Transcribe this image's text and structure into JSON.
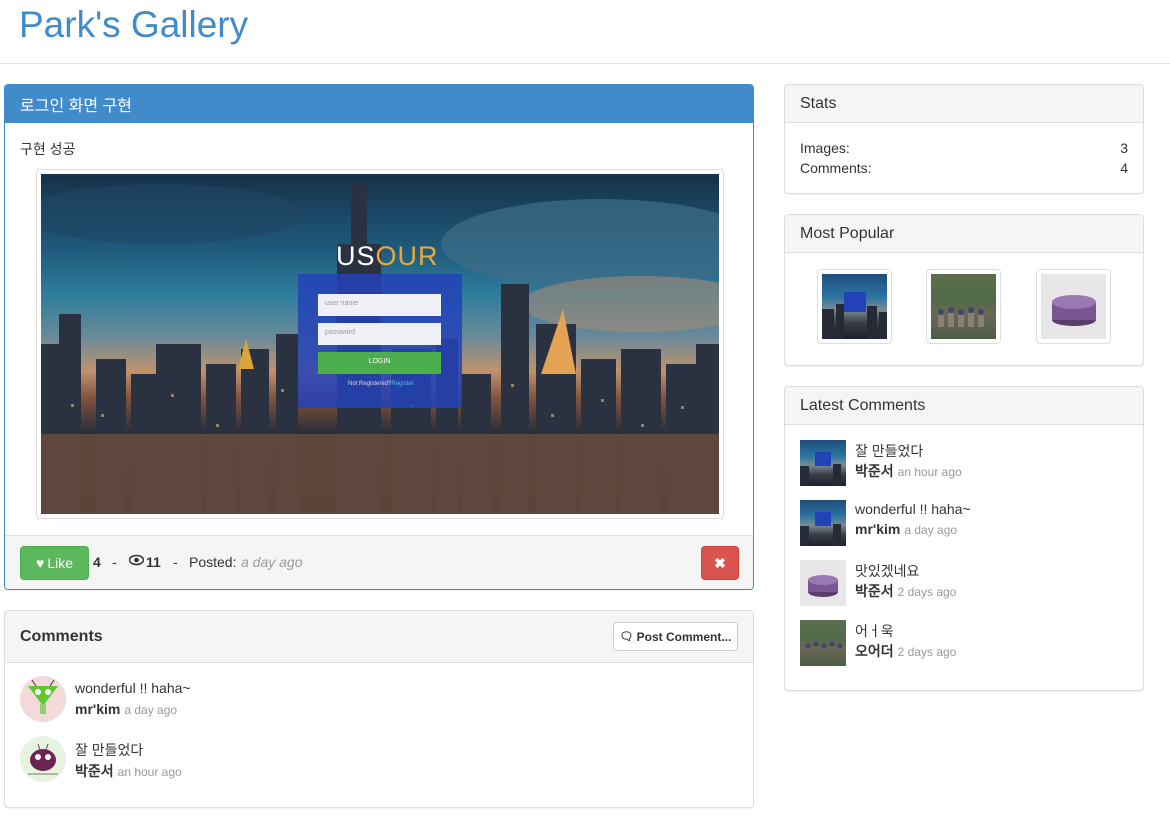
{
  "brand": "Park's Gallery",
  "post": {
    "title": "로그인 화면 구현",
    "body": "구현 성공",
    "screenshot": {
      "logo_left": "US",
      "logo_right": "OUR",
      "username_placeholder": "user name",
      "password_placeholder": "password",
      "login_button": "LOGIN",
      "register_text": "Not Registered?",
      "register_link": "Register"
    },
    "like_label": "Like",
    "like_count": "4",
    "separator": "-",
    "view_count": "11",
    "posted_label": "Posted:",
    "posted_time": "a day ago",
    "colors": {
      "like": "#5cb85c",
      "delete": "#d9534f",
      "primary": "#428bca"
    }
  },
  "comments": {
    "title": "Comments",
    "post_button": "Post Comment...",
    "items": [
      {
        "text": "wonderful !! haha~",
        "author": "mr'kim",
        "time": "a day ago",
        "avatar": "green-alien-avatar"
      },
      {
        "text": "잘 만들었다",
        "author": "박준서",
        "time": "an hour ago",
        "avatar": "purple-alien-avatar"
      }
    ]
  },
  "stats": {
    "title": "Stats",
    "rows": [
      {
        "label": "Images:",
        "value": "3"
      },
      {
        "label": "Comments:",
        "value": "4"
      }
    ]
  },
  "popular": {
    "title": "Most Popular",
    "images": [
      "city-login-thumbnail",
      "group-photo-thumbnail",
      "purple-cake-thumbnail"
    ]
  },
  "latest": {
    "title": "Latest Comments",
    "items": [
      {
        "text": "잘 만들었다",
        "author": "박준서",
        "time": "an hour ago",
        "image": "city-login-thumbnail"
      },
      {
        "text": "wonderful !! haha~",
        "author": "mr'kim",
        "time": "a day ago",
        "image": "city-login-thumbnail"
      },
      {
        "text": "맛있겠네요",
        "author": "박준서",
        "time": "2 days ago",
        "image": "purple-cake-thumbnail"
      },
      {
        "text": "어ㅓ욱",
        "author": "오어더",
        "time": "2 days ago",
        "image": "group-photo-thumbnail"
      }
    ]
  }
}
